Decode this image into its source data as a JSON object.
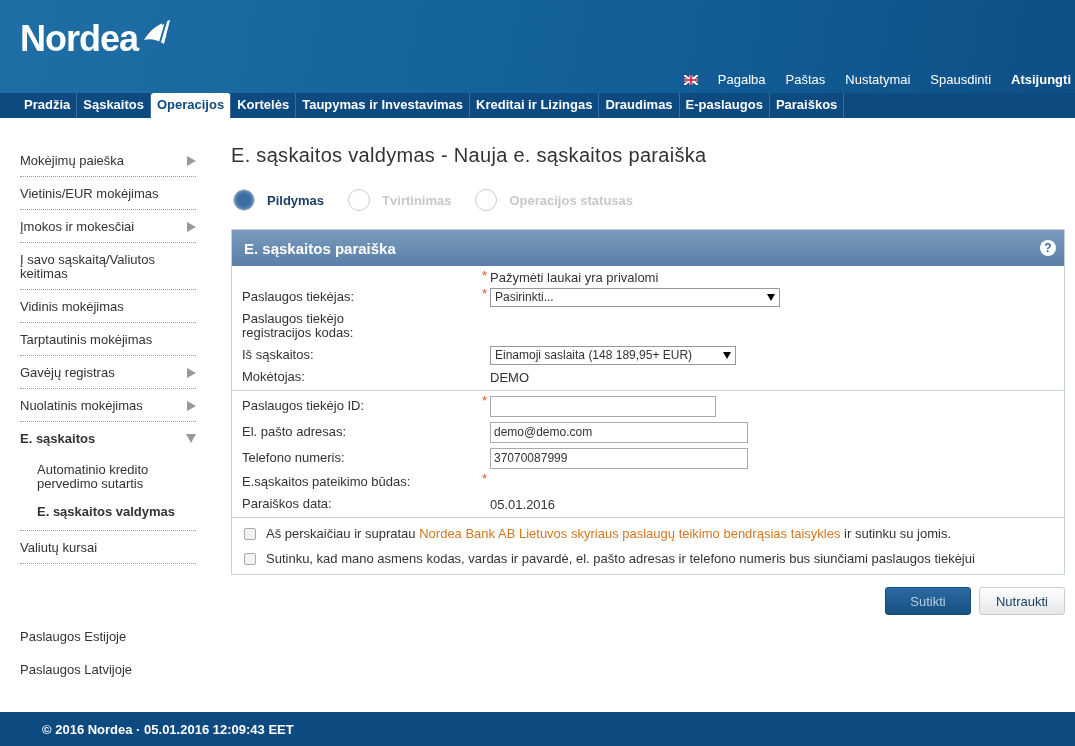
{
  "header": {
    "logo": "Nordea",
    "top_links": [
      {
        "label": "Pagalba",
        "bold": false
      },
      {
        "label": "Paštas",
        "bold": false
      },
      {
        "label": "Nustatymai",
        "bold": false
      },
      {
        "label": "Spausdinti",
        "bold": false
      },
      {
        "label": "Atsijungti",
        "bold": true
      }
    ],
    "nav": [
      {
        "label": "Pradžia",
        "selected": false
      },
      {
        "label": "Sąskaitos",
        "selected": false
      },
      {
        "label": "Operacijos",
        "selected": true
      },
      {
        "label": "Kortelės",
        "selected": false
      },
      {
        "label": "Taupymas ir Investavimas",
        "selected": false
      },
      {
        "label": "Kreditai ir Lizingas",
        "selected": false
      },
      {
        "label": "Draudimas",
        "selected": false
      },
      {
        "label": "E-paslaugos",
        "selected": false
      },
      {
        "label": "Paraiškos",
        "selected": false
      }
    ]
  },
  "sidebar": {
    "items": [
      {
        "label": "Mokėjimų paieška",
        "submenu": true,
        "expanded": false
      },
      {
        "label": "Vietinis/EUR mokėjimas",
        "submenu": false,
        "expanded": false
      },
      {
        "label": "Įmokos ir mokesčiai",
        "submenu": true,
        "expanded": false
      },
      {
        "label": "Į savo sąskaitą/Valiutos keitimas",
        "submenu": false,
        "expanded": false
      },
      {
        "label": "Vidinis mokėjimas",
        "submenu": false,
        "expanded": false
      },
      {
        "label": "Tarptautinis mokėjimas",
        "submenu": false,
        "expanded": false
      },
      {
        "label": "Gavėjų registras",
        "submenu": true,
        "expanded": false
      },
      {
        "label": "Nuolatinis mokėjimas",
        "submenu": true,
        "expanded": false
      },
      {
        "label": "E. sąskaitos",
        "submenu": true,
        "expanded": true,
        "children": [
          {
            "label": "Automatinio kredito pervedimo sutartis",
            "selected": false
          },
          {
            "label": "E. sąskaitos valdymas",
            "selected": true
          }
        ]
      },
      {
        "label": "Valiutų kursai",
        "submenu": false,
        "expanded": false
      }
    ],
    "extra_links": [
      "Paslaugos Estijoje",
      "Paslaugos Latvijoje"
    ]
  },
  "page_title": "E. sąskaitos valdymas - Nauja e. sąskaitos paraiška",
  "steps": [
    {
      "label": "Pildymas",
      "selected": true
    },
    {
      "label": "Tvirtinimas",
      "selected": false
    },
    {
      "label": "Operacijos statusas",
      "selected": false
    }
  ],
  "panel": {
    "title": "E. sąskaitos paraiška",
    "help": "?",
    "required_mark": "*",
    "required_note": "Pažymėti laukai yra privalomi",
    "groups": [
      [
        {
          "label": "Paslaugos tiekėjas:",
          "kind": "select",
          "star": "*",
          "value": "Pasirinkti..."
        },
        {
          "label": "Paslaugos tiekėjo registracijos kodas:",
          "kind": "empty"
        },
        {
          "label": "Iš sąskaitos:",
          "kind": "select-short",
          "value": "Einamoji saslaita (148 189,95+ EUR)"
        },
        {
          "label": "Mokėtojas:",
          "kind": "text",
          "value": "DEMO"
        }
      ],
      [
        {
          "label": "Paslaugos tiekėjo ID:",
          "kind": "input-short",
          "star": "*"
        },
        {
          "label": "El. pašto adresas:",
          "kind": "input",
          "value": "demo@demo.com"
        },
        {
          "label": "Telefono numeris:",
          "kind": "input",
          "value": "37070087999"
        },
        {
          "label": "E.sąskaitos pateikimo būdas:",
          "kind": "empty",
          "star": "*"
        },
        {
          "label": "Paraiškos data:",
          "kind": "text",
          "value": "05.01.2016"
        }
      ]
    ],
    "agreements": [
      {
        "before": "Aš perskaičiau ir supratau",
        "link": "Nordea Bank AB Lietuvos skyriaus paslaugų teikimo bendrąsias taisykles",
        "after": "ir sutinku su jomis.",
        "checked": false
      },
      {
        "before": "Sutinku, kad mano asmens kodas, vardas ir pavardė, el. pašto adresas ir telefono numeris bus siunčiami paslaugos tiekėjui",
        "checked": false
      }
    ]
  },
  "buttons": [
    {
      "label": "Sutikti",
      "kind": "primary"
    },
    {
      "label": "Nutraukti",
      "kind": "secondary"
    }
  ],
  "footer": "© 2016 Nordea · 05.01.2016 12:09:43 EET"
}
